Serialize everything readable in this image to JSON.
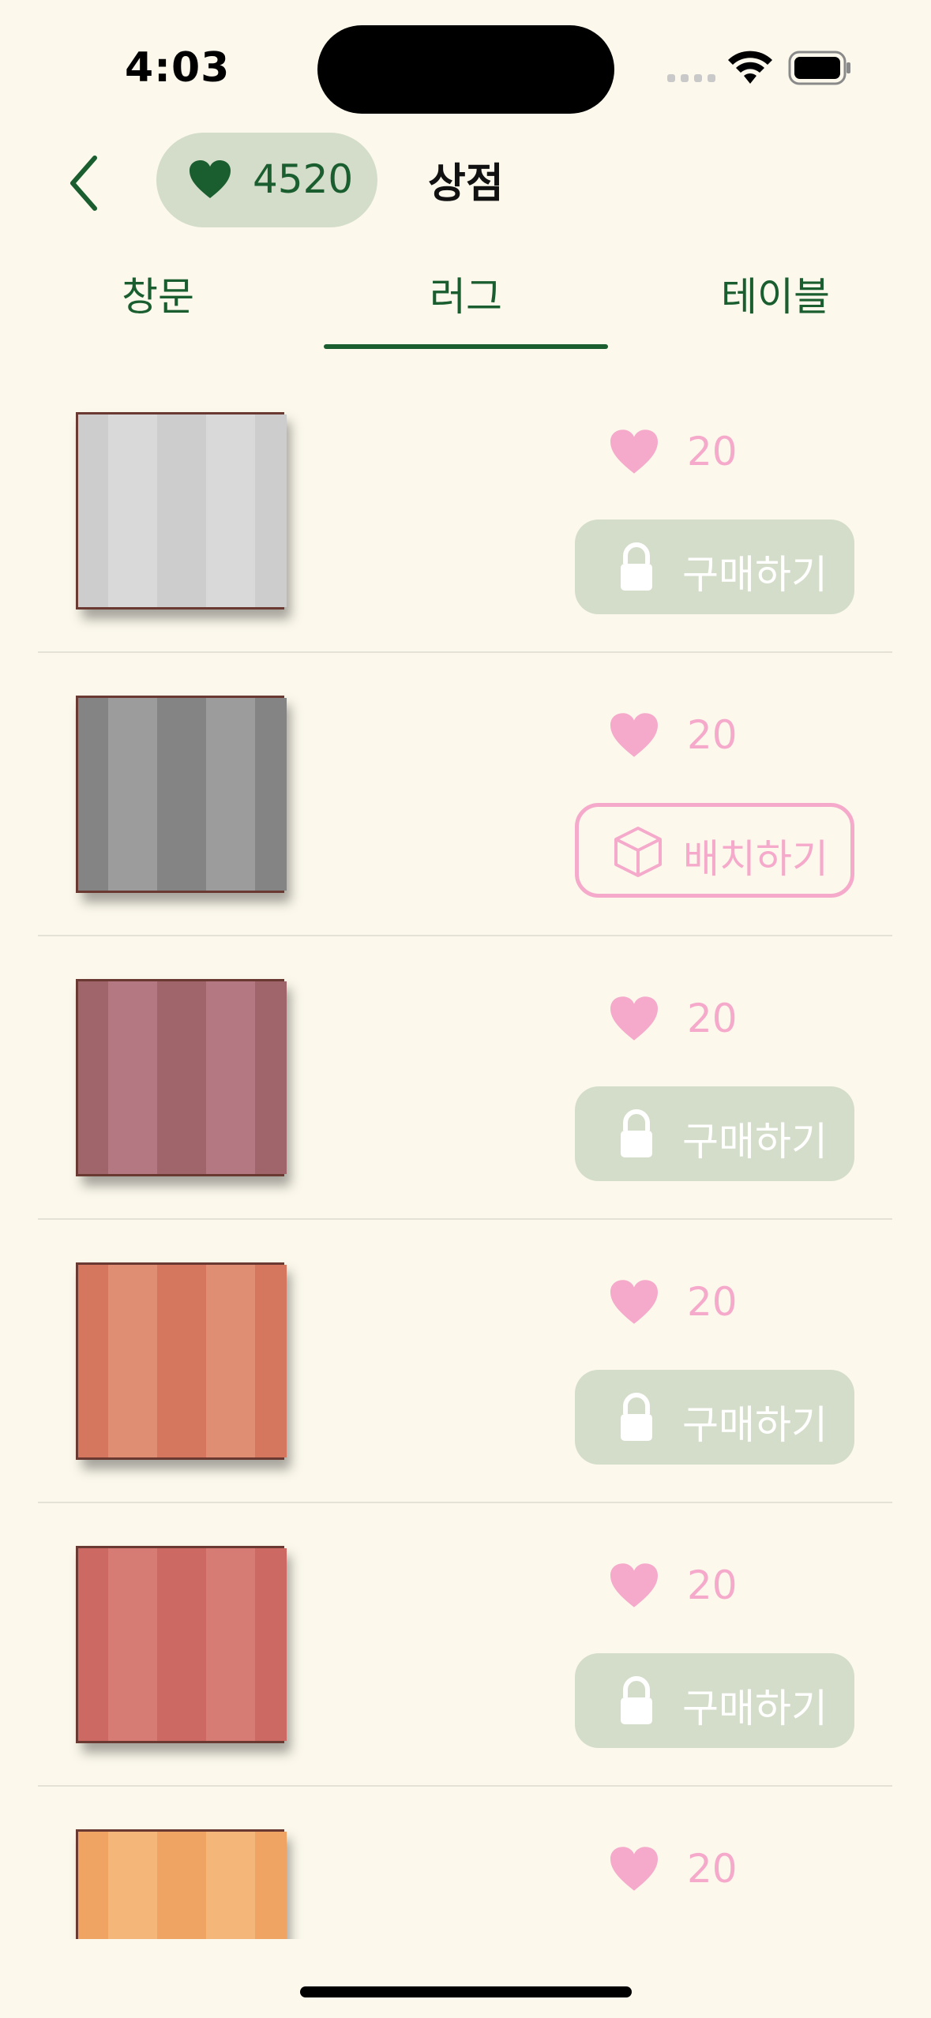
{
  "status_bar": {
    "time": "4:03"
  },
  "header": {
    "hearts_count": "4520",
    "title": "상점"
  },
  "tabs": [
    {
      "label": "창문",
      "selected": false
    },
    {
      "label": "러그",
      "selected": true
    },
    {
      "label": "테이블",
      "selected": false
    }
  ],
  "items": [
    {
      "price": "20",
      "action": "구매하기",
      "state": "locked",
      "colors": {
        "base": "#d9d9d9",
        "stripe": "#cdcdcd"
      }
    },
    {
      "price": "20",
      "action": "배치하기",
      "state": "owned",
      "colors": {
        "base": "#9c9c9c",
        "stripe": "#848484"
      }
    },
    {
      "price": "20",
      "action": "구매하기",
      "state": "locked",
      "colors": {
        "base": "#b47883",
        "stripe": "#9f656b"
      }
    },
    {
      "price": "20",
      "action": "구매하기",
      "state": "locked",
      "colors": {
        "base": "#df8d73",
        "stripe": "#d5765f"
      }
    },
    {
      "price": "20",
      "action": "구매하기",
      "state": "locked",
      "colors": {
        "base": "#d77b75",
        "stripe": "#cb6962"
      }
    },
    {
      "price": "20",
      "action": "",
      "state": "partial",
      "colors": {
        "base": "#f4b679",
        "stripe": "#efa463"
      }
    }
  ],
  "theme": {
    "accent": "#1a5e2f",
    "pink": "#f6aacb",
    "pill": "#d3ddc9",
    "background": "#fcf9ec"
  }
}
